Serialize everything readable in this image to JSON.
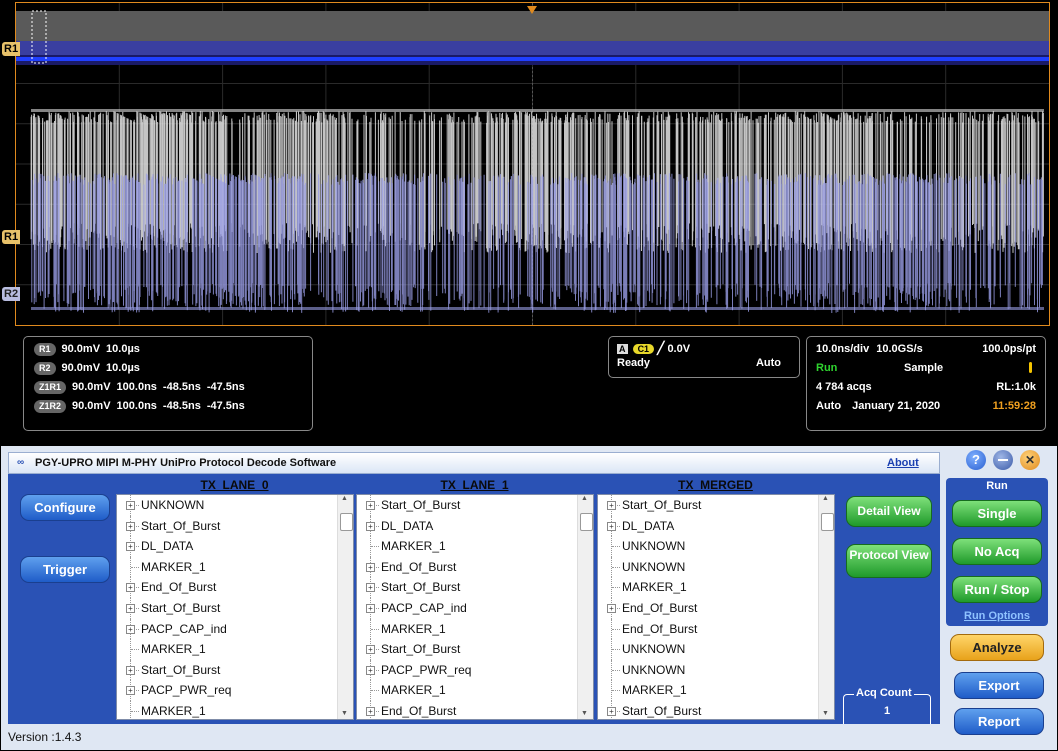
{
  "scope": {
    "markers": {
      "r1_top": "R1",
      "r1_mid": "R1",
      "r2_bottom": "R2"
    },
    "channels": [
      {
        "badge": "R1",
        "scale": "90.0mV",
        "time": "10.0µs",
        "pos1": "",
        "pos2": ""
      },
      {
        "badge": "R2",
        "scale": "90.0mV",
        "time": "10.0µs",
        "pos1": "",
        "pos2": ""
      },
      {
        "badge": "Z1R1",
        "scale": "90.0mV",
        "time": "100.0ns",
        "pos1": "-48.5ns",
        "pos2": "-47.5ns"
      },
      {
        "badge": "Z1R2",
        "scale": "90.0mV",
        "time": "100.0ns",
        "pos1": "-48.5ns",
        "pos2": "-47.5ns"
      }
    ],
    "trigger": {
      "mode_badge": "A",
      "source": "C1",
      "level": "0.0V",
      "status": "Ready",
      "mode": "Auto"
    },
    "acq": {
      "timebase": "10.0ns/div",
      "rate": "10.0GS/s",
      "resolution": "100.0ps/pt",
      "state": "Run",
      "sampling": "Sample",
      "acqs": "4 784 acqs",
      "record_length": "RL:1.0k",
      "mode": "Auto",
      "date": "January 21, 2020",
      "time": "11:59:28"
    }
  },
  "app": {
    "title": "PGY-UPRO MIPI M-PHY UniPro Protocol Decode Software",
    "about_label": "About",
    "left_buttons": {
      "configure": "Configure",
      "trigger": "Trigger"
    },
    "lanes": [
      {
        "header": "TX_LANE_0",
        "items": [
          {
            "label": "UNKNOWN",
            "expandable": true
          },
          {
            "label": "Start_Of_Burst",
            "expandable": true
          },
          {
            "label": "DL_DATA",
            "expandable": true
          },
          {
            "label": "MARKER_1",
            "expandable": false
          },
          {
            "label": "End_Of_Burst",
            "expandable": true
          },
          {
            "label": "Start_Of_Burst",
            "expandable": true
          },
          {
            "label": "PACP_CAP_ind",
            "expandable": true
          },
          {
            "label": "MARKER_1",
            "expandable": false
          },
          {
            "label": "Start_Of_Burst",
            "expandable": true
          },
          {
            "label": "PACP_PWR_req",
            "expandable": true
          },
          {
            "label": "MARKER_1",
            "expandable": false
          }
        ]
      },
      {
        "header": "TX_LANE_1",
        "items": [
          {
            "label": "Start_Of_Burst",
            "expandable": true
          },
          {
            "label": "DL_DATA",
            "expandable": true
          },
          {
            "label": "MARKER_1",
            "expandable": false
          },
          {
            "label": "End_Of_Burst",
            "expandable": true
          },
          {
            "label": "Start_Of_Burst",
            "expandable": true
          },
          {
            "label": "PACP_CAP_ind",
            "expandable": true
          },
          {
            "label": "MARKER_1",
            "expandable": false
          },
          {
            "label": "Start_Of_Burst",
            "expandable": true
          },
          {
            "label": "PACP_PWR_req",
            "expandable": true
          },
          {
            "label": "MARKER_1",
            "expandable": false
          },
          {
            "label": "End_Of_Burst",
            "expandable": true
          }
        ]
      },
      {
        "header": "TX_MERGED",
        "items": [
          {
            "label": "Start_Of_Burst",
            "expandable": true
          },
          {
            "label": "DL_DATA",
            "expandable": true
          },
          {
            "label": "UNKNOWN",
            "expandable": false
          },
          {
            "label": "UNKNOWN",
            "expandable": false
          },
          {
            "label": "MARKER_1",
            "expandable": false
          },
          {
            "label": "End_Of_Burst",
            "expandable": true
          },
          {
            "label": "End_Of_Burst",
            "expandable": false
          },
          {
            "label": "UNKNOWN",
            "expandable": false
          },
          {
            "label": "UNKNOWN",
            "expandable": false
          },
          {
            "label": "MARKER_1",
            "expandable": false
          },
          {
            "label": "Start_Of_Burst",
            "expandable": true
          }
        ]
      }
    ],
    "view_buttons": {
      "detail": "Detail View",
      "protocol": "Protocol View"
    },
    "acq_count": {
      "label": "Acq Count",
      "value": "1"
    },
    "version": "Version :1.4.3",
    "right_panel": {
      "run_header": "Run",
      "single": "Single",
      "no_acq": "No Acq",
      "run_stop": "Run / Stop",
      "run_options": "Run Options",
      "analyze": "Analyze",
      "export": "Export",
      "report": "Report",
      "help_glyph": "?"
    }
  },
  "colors": {
    "frame_orange": "#e08a1e",
    "wave_white": "#e6e6e6",
    "wave_blue": "#9a9ee6",
    "accent_blue": "#2a52b5"
  }
}
